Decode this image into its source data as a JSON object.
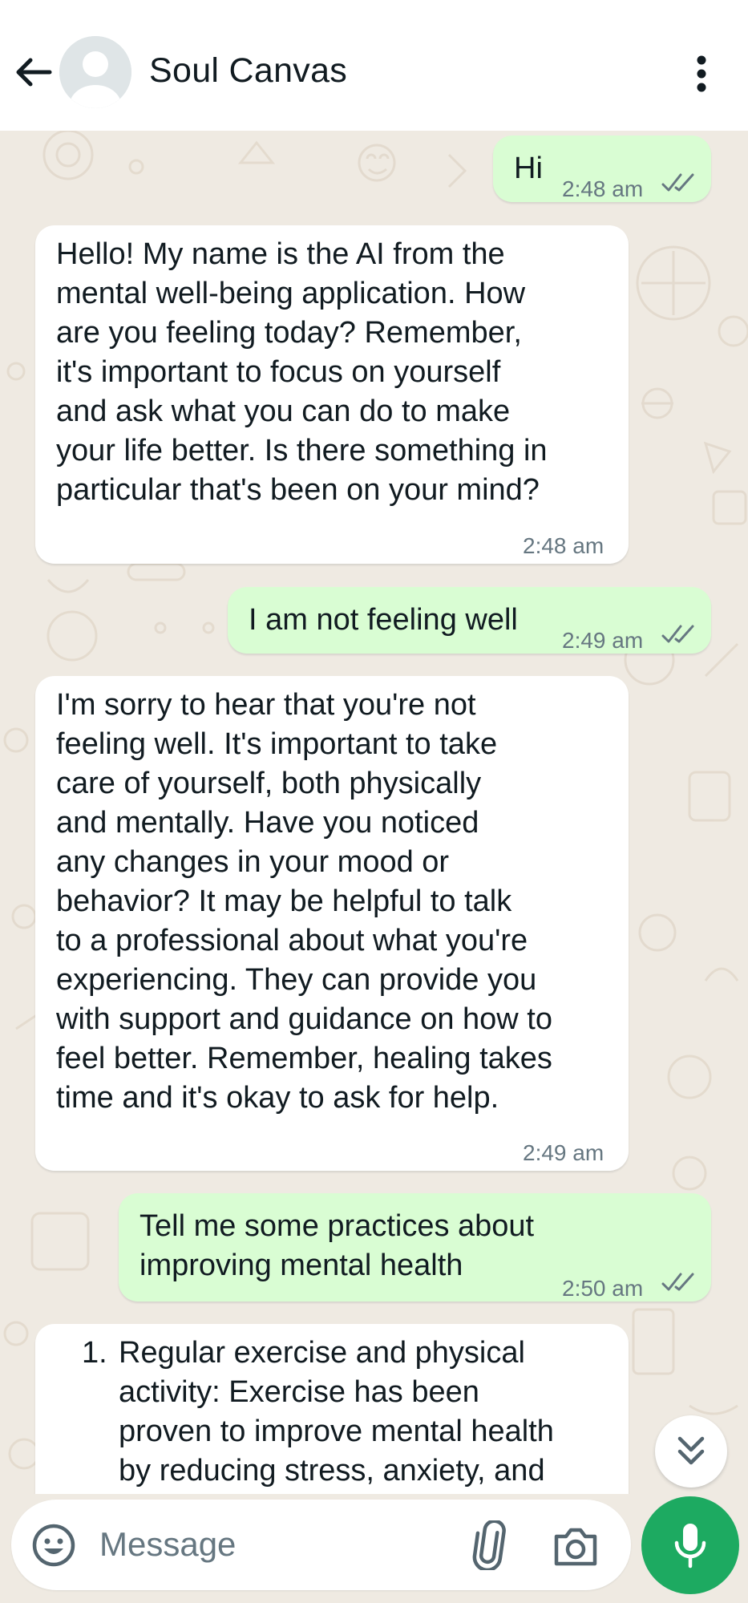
{
  "header": {
    "title": "Soul Canvas",
    "back_icon": "arrow-left-icon",
    "avatar_icon": "default-avatar-icon",
    "menu_icon": "more-vertical-icon"
  },
  "messages": [
    {
      "direction": "outgoing",
      "text": "Hi",
      "time": "2:48 am",
      "status": "read"
    },
    {
      "direction": "incoming",
      "text": "Hello! My name is the AI from the\nmental well-being application. How\nare you feeling today? Remember,\nit's important to focus on yourself\nand ask what you can do to make\nyour life better. Is there something in\nparticular that's been on your mind?",
      "time": "2:48 am"
    },
    {
      "direction": "outgoing",
      "text": "I am not feeling well",
      "time": "2:49 am",
      "status": "read"
    },
    {
      "direction": "incoming",
      "text": "I'm sorry to hear that you're not\nfeeling well. It's important to take\ncare of yourself, both physically\nand mentally. Have you noticed\nany changes in your mood or\nbehavior? It may be helpful to talk\nto a professional about what you're\nexperiencing. They can provide you\nwith support and guidance on how to\nfeel better. Remember, healing takes\ntime and it's okay to ask for help.",
      "time": "2:49 am"
    },
    {
      "direction": "outgoing",
      "text": "Tell me some practices about\nimproving mental health",
      "time": "2:50 am",
      "status": "read"
    },
    {
      "direction": "incoming",
      "list_number": "1.",
      "text": "Regular exercise and physical\nactivity: Exercise has been\nproven to improve mental health\nby reducing stress, anxiety, and"
    }
  ],
  "composer": {
    "placeholder": "Message",
    "emoji_icon": "emoji-icon",
    "attach_icon": "paperclip-icon",
    "camera_icon": "camera-icon",
    "mic_icon": "microphone-icon",
    "scroll_icon": "double-chevron-down-icon"
  },
  "colors": {
    "outgoing_bubble": "#d9fdd3",
    "incoming_bubble": "#ffffff",
    "chat_background": "#efeae2",
    "accent_green": "#1daa61",
    "read_ticks": "#667781"
  }
}
